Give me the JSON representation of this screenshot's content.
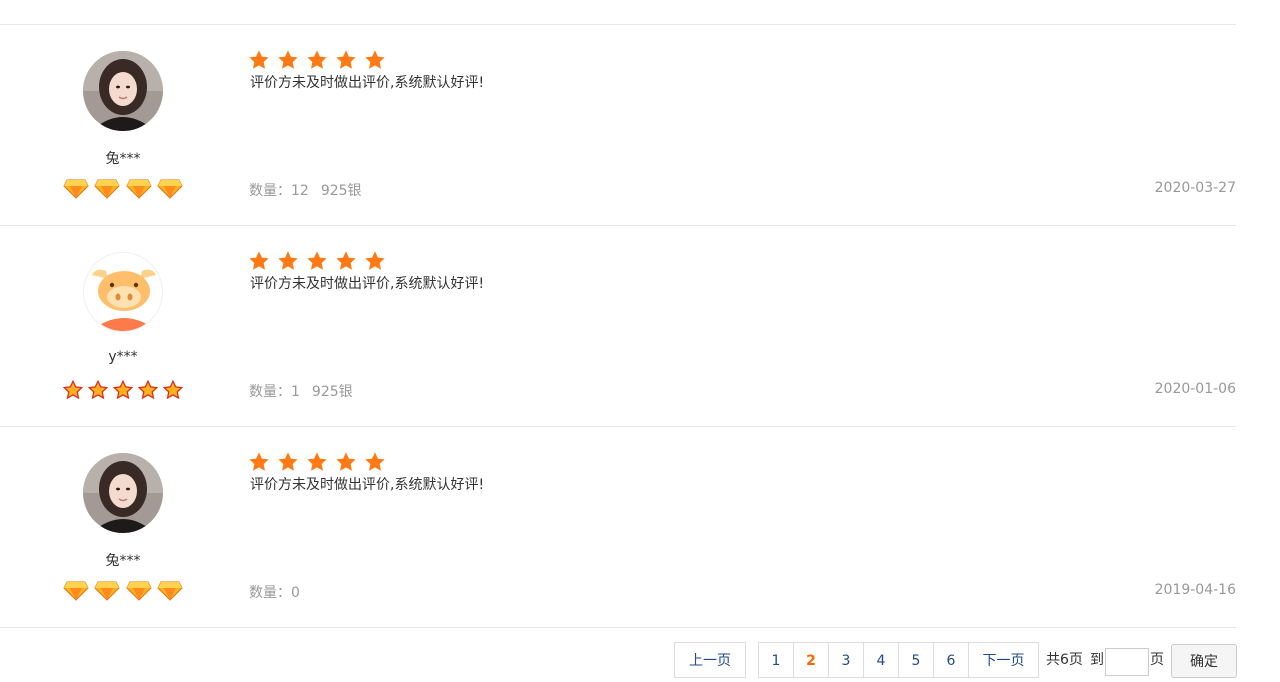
{
  "reviews": [
    {
      "user": "兔***",
      "avatar": "woman-photo-avatar",
      "level_icon": "diamond-icon",
      "level_count": 4,
      "rating": 5,
      "content": "评价方未及时做出评价,系统默认好评!",
      "quantity_label": "数量：",
      "quantity": "12",
      "material": "925银",
      "date": "2020-03-27"
    },
    {
      "user": "y***",
      "avatar": "cow-cartoon-avatar",
      "level_icon": "red-star-icon",
      "level_count": 5,
      "rating": 5,
      "content": "评价方未及时做出评价,系统默认好评!",
      "quantity_label": "数量：",
      "quantity": "1",
      "material": "925银",
      "date": "2020-01-06"
    },
    {
      "user": "兔***",
      "avatar": "woman-photo-avatar",
      "level_icon": "diamond-icon",
      "level_count": 4,
      "rating": 5,
      "content": "评价方未及时做出评价,系统默认好评!",
      "quantity_label": "数量：",
      "quantity": "0",
      "material": "",
      "date": "2019-04-16"
    }
  ],
  "pagination": {
    "prev": "上一页",
    "pages": [
      "1",
      "2",
      "3",
      "4",
      "5",
      "6"
    ],
    "current": "2",
    "next": "下一页",
    "total": "共6页",
    "goto": "到",
    "page_unit": "页",
    "confirm": "确定"
  },
  "colors": {
    "star": "#ff7a14",
    "link": "#1f4b8a",
    "active_page": "#ff6600",
    "muted": "#999999"
  }
}
